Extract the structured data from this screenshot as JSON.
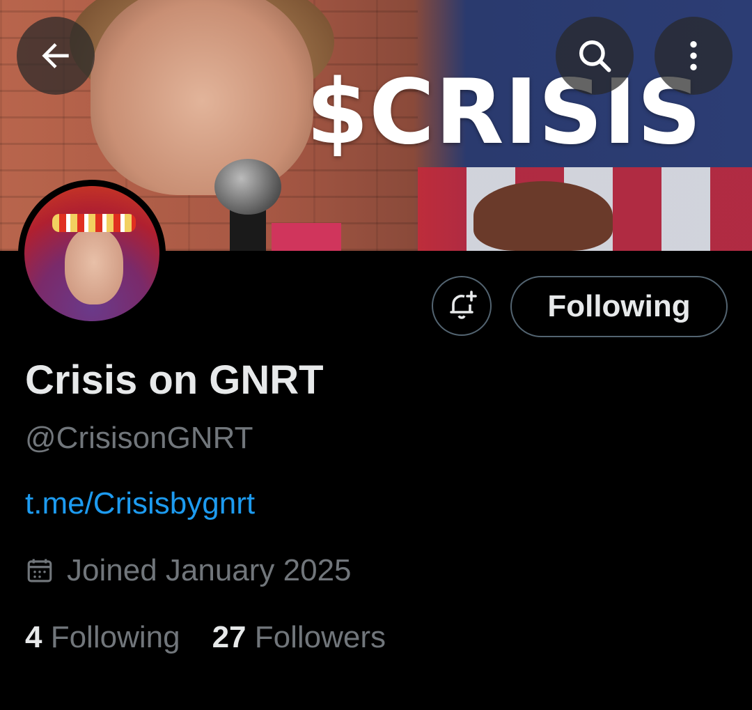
{
  "banner": {
    "text": "$CRISIS"
  },
  "header": {
    "back_icon": "arrow-left-icon",
    "search_icon": "search-icon",
    "more_icon": "more-vertical-icon"
  },
  "profile": {
    "display_name": "Crisis on GNRT",
    "handle": "@CrisisonGNRT",
    "link": "t.me/Crisisbygnrt",
    "joined": "Joined January 2025",
    "following_count": "4",
    "following_label": "Following",
    "followers_count": "27",
    "followers_label": "Followers"
  },
  "actions": {
    "notify_icon": "bell-plus-icon",
    "follow_button_label": "Following"
  },
  "colors": {
    "background": "#000000",
    "text_primary": "#e7e9ea",
    "text_secondary": "#71767b",
    "link": "#1d9bf0",
    "border": "#536471"
  }
}
